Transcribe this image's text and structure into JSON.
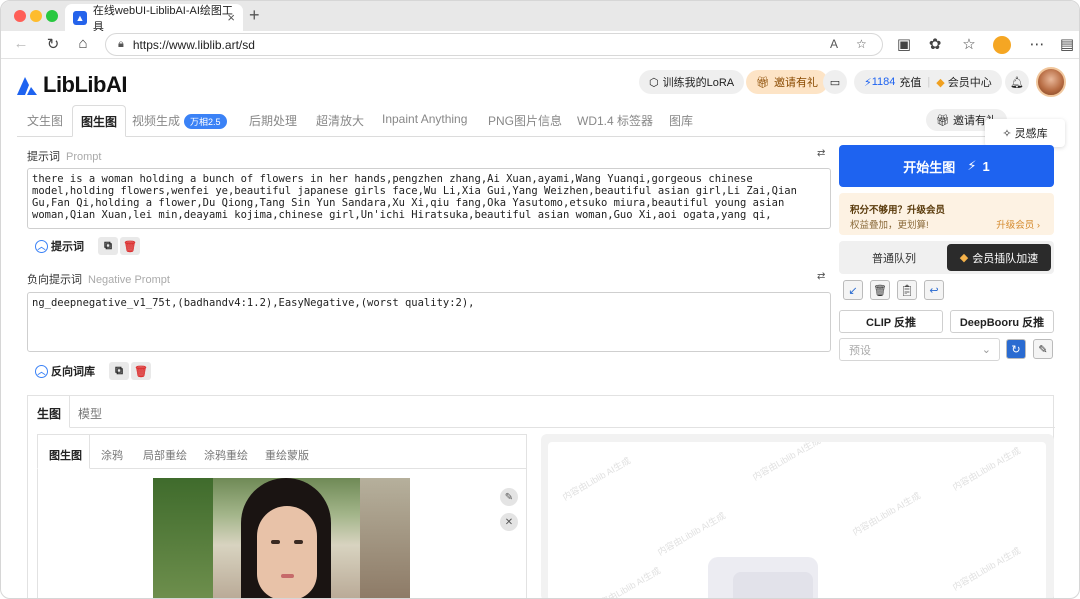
{
  "browser": {
    "tab_title": "在线webUI-LiblibAI-AI绘图工具",
    "url": "https://www.liblib.art/sd",
    "tab_close": "×",
    "new_tab": "+"
  },
  "header": {
    "logo_text": "LibLibAI",
    "train_lora": "训练我的LoRA",
    "invite": "邀请有礼",
    "credits": "1184",
    "recharge": "充值",
    "member_center": "会员中心"
  },
  "tabs": [
    {
      "label": "文生图"
    },
    {
      "label": "图生图"
    },
    {
      "label": "视频生成",
      "badge": "万相2.5"
    },
    {
      "label": "后期处理"
    },
    {
      "label": "超清放大"
    },
    {
      "label": "Inpaint Anything"
    },
    {
      "label": "PNG图片信息"
    },
    {
      "label": "WD1.4 标签器"
    },
    {
      "label": "图库"
    }
  ],
  "tab_right": {
    "invite": "邀请有礼",
    "inspiration": "灵感库"
  },
  "prompt": {
    "label": "提示词",
    "label_en": "Prompt",
    "value": "there is a woman holding a bunch of flowers in her hands,pengzhen zhang,Ai Xuan,ayami,Wang Yuanqi,gorgeous chinese model,holding flowers,wenfei ye,beautiful japanese girls face,Wu Li,Xia Gui,Yang Weizhen,beautiful asian girl,Li Zai,Qian Gu,Fan Qi,holding a flower,Du Qiong,Tang Sin Yun Sandara,Xu Xi,qiu fang,Oka Yasutomo,etsuko miura,beautiful young asian woman,Qian Xuan,lei min,deayami kojima,chinese girl,Un'ichi Hiratsuka,beautiful asian woman,Guo Xi,aoi ogata,yang qi,",
    "toggle_label": "提示词"
  },
  "negative": {
    "label": "负向提示词",
    "label_en": "Negative Prompt",
    "value": "ng_deepnegative_v1_75t,(badhandv4:1.2),EasyNegative,(worst quality:2),",
    "toggle_label": "反向词库"
  },
  "generate": {
    "label": "开始生图",
    "cost": "1"
  },
  "vip": {
    "title": "积分不够用？升级会员",
    "subtitle": "权益叠加，更划算!",
    "link": "升级会员 ›"
  },
  "queue": {
    "normal": "普通队列",
    "priority": "会员插队加速"
  },
  "interrogate": {
    "clip": "CLIP 反推",
    "deepbooru": "DeepBooru 反推"
  },
  "preset": {
    "placeholder": "预设"
  },
  "lower_tabs": [
    {
      "label": "生图"
    },
    {
      "label": "模型"
    }
  ],
  "img_tabs": [
    {
      "label": "图生图"
    },
    {
      "label": "涂鸦"
    },
    {
      "label": "局部重绘"
    },
    {
      "label": "涂鸦重绘"
    },
    {
      "label": "重绘蒙版"
    }
  ],
  "watermark": "内容由Liblib AI生成",
  "colors": {
    "accent": "#1e63f0",
    "vip_bg": "#fdf2e3",
    "priority_bg": "#2b2b2b"
  },
  "icons": {
    "delete": "trash-icon",
    "copy": "copy-icon",
    "edit": "pencil-icon",
    "close": "close-icon"
  }
}
